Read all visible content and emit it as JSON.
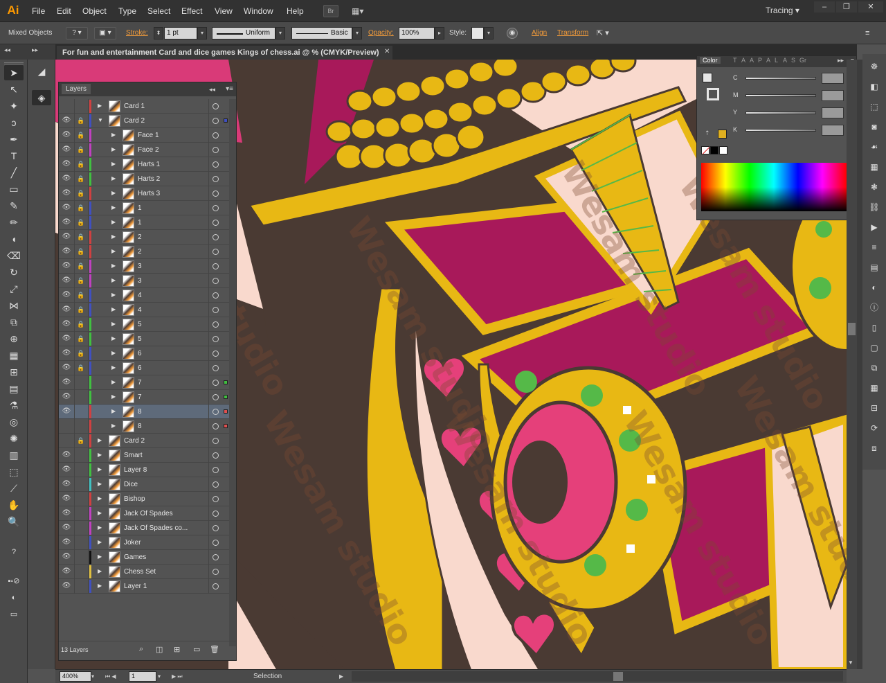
{
  "app": {
    "logo": "Ai"
  },
  "menu": [
    "File",
    "Edit",
    "Object",
    "Type",
    "Select",
    "Effect",
    "View",
    "Window",
    "Help"
  ],
  "workspace": {
    "label": "Tracing",
    "bridge_label": "Br"
  },
  "control_bar": {
    "selection_label": "Mixed Objects",
    "stroke_label": "Stroke:",
    "stroke_value": "1 pt",
    "profile_value": "Uniform",
    "brush_value": "Basic",
    "opacity_label": "Opacity:",
    "opacity_value": "100%",
    "style_label": "Style:",
    "align_label": "Align",
    "transform_label": "Transform"
  },
  "document": {
    "tab_title": "For fun and entertainment Card and dice games Kings of chess.ai @ % (CMYK/Preview)",
    "close": "✕"
  },
  "layers_panel": {
    "title": "Layers",
    "count_label": "13 Layers",
    "rows": [
      {
        "name": "Card 1",
        "indent": 0,
        "color": "#d04040",
        "eye": false,
        "lock": false,
        "expanded": false,
        "sel": "",
        "highlight": false
      },
      {
        "name": "Card 2",
        "indent": 0,
        "color": "#4050c0",
        "eye": true,
        "lock": true,
        "expanded": true,
        "sel": "#4050c0",
        "highlight": false
      },
      {
        "name": "Face 1",
        "indent": 1,
        "color": "#c040c0",
        "eye": true,
        "lock": true,
        "expanded": false,
        "sel": "",
        "highlight": false
      },
      {
        "name": "Face 2",
        "indent": 1,
        "color": "#c040c0",
        "eye": true,
        "lock": true,
        "expanded": false,
        "sel": "",
        "highlight": false
      },
      {
        "name": "Harts 1",
        "indent": 1,
        "color": "#40c040",
        "eye": true,
        "lock": true,
        "expanded": false,
        "sel": "",
        "highlight": false
      },
      {
        "name": "Harts 2",
        "indent": 1,
        "color": "#40c040",
        "eye": true,
        "lock": true,
        "expanded": false,
        "sel": "",
        "highlight": false
      },
      {
        "name": "Harts 3",
        "indent": 1,
        "color": "#d04040",
        "eye": true,
        "lock": true,
        "expanded": false,
        "sel": "",
        "highlight": false
      },
      {
        "name": "1",
        "indent": 1,
        "color": "#4050c0",
        "eye": true,
        "lock": true,
        "expanded": false,
        "sel": "",
        "highlight": false
      },
      {
        "name": "1",
        "indent": 1,
        "color": "#4050c0",
        "eye": true,
        "lock": true,
        "expanded": false,
        "sel": "",
        "highlight": false
      },
      {
        "name": "2",
        "indent": 1,
        "color": "#d04040",
        "eye": true,
        "lock": true,
        "expanded": false,
        "sel": "",
        "highlight": false
      },
      {
        "name": "2",
        "indent": 1,
        "color": "#d04040",
        "eye": true,
        "lock": true,
        "expanded": false,
        "sel": "",
        "highlight": false
      },
      {
        "name": "3",
        "indent": 1,
        "color": "#c040c0",
        "eye": true,
        "lock": true,
        "expanded": false,
        "sel": "",
        "highlight": false
      },
      {
        "name": "3",
        "indent": 1,
        "color": "#c040c0",
        "eye": true,
        "lock": true,
        "expanded": false,
        "sel": "",
        "highlight": false
      },
      {
        "name": "4",
        "indent": 1,
        "color": "#4050c0",
        "eye": true,
        "lock": true,
        "expanded": false,
        "sel": "",
        "highlight": false
      },
      {
        "name": "4",
        "indent": 1,
        "color": "#4050c0",
        "eye": true,
        "lock": true,
        "expanded": false,
        "sel": "",
        "highlight": false
      },
      {
        "name": "5",
        "indent": 1,
        "color": "#40c040",
        "eye": true,
        "lock": true,
        "expanded": false,
        "sel": "",
        "highlight": false
      },
      {
        "name": "5",
        "indent": 1,
        "color": "#40c040",
        "eye": true,
        "lock": true,
        "expanded": false,
        "sel": "",
        "highlight": false
      },
      {
        "name": "6",
        "indent": 1,
        "color": "#4050c0",
        "eye": true,
        "lock": true,
        "expanded": false,
        "sel": "",
        "highlight": false
      },
      {
        "name": "6",
        "indent": 1,
        "color": "#4050c0",
        "eye": true,
        "lock": true,
        "expanded": false,
        "sel": "",
        "highlight": false
      },
      {
        "name": "7",
        "indent": 1,
        "color": "#40c040",
        "eye": true,
        "lock": false,
        "expanded": false,
        "sel": "#40c040",
        "highlight": false
      },
      {
        "name": "7",
        "indent": 1,
        "color": "#40c040",
        "eye": true,
        "lock": false,
        "expanded": false,
        "sel": "#40c040",
        "highlight": false
      },
      {
        "name": "8",
        "indent": 1,
        "color": "#d04040",
        "eye": true,
        "lock": false,
        "expanded": false,
        "sel": "#e05050",
        "highlight": true
      },
      {
        "name": "8",
        "indent": 1,
        "color": "#d04040",
        "eye": false,
        "lock": false,
        "expanded": false,
        "sel": "#e05050",
        "highlight": false
      },
      {
        "name": "Card 2",
        "indent": 0,
        "color": "#d04040",
        "eye": false,
        "lock": true,
        "expanded": false,
        "sel": "",
        "highlight": false
      },
      {
        "name": "Smart",
        "indent": 0,
        "color": "#40c040",
        "eye": true,
        "lock": false,
        "expanded": false,
        "sel": "",
        "highlight": false
      },
      {
        "name": "Layer 8",
        "indent": 0,
        "color": "#40c040",
        "eye": true,
        "lock": false,
        "expanded": false,
        "sel": "",
        "highlight": false
      },
      {
        "name": "Dice",
        "indent": 0,
        "color": "#40c0c0",
        "eye": true,
        "lock": false,
        "expanded": false,
        "sel": "",
        "highlight": false
      },
      {
        "name": "Bishop",
        "indent": 0,
        "color": "#d04040",
        "eye": true,
        "lock": false,
        "expanded": false,
        "sel": "",
        "highlight": false
      },
      {
        "name": "Jack Of Spades",
        "indent": 0,
        "color": "#c040c0",
        "eye": true,
        "lock": false,
        "expanded": false,
        "sel": "",
        "highlight": false
      },
      {
        "name": "Jack Of Spades co...",
        "indent": 0,
        "color": "#c040c0",
        "eye": true,
        "lock": false,
        "expanded": false,
        "sel": "",
        "highlight": false
      },
      {
        "name": "Joker",
        "indent": 0,
        "color": "#4050c0",
        "eye": true,
        "lock": false,
        "expanded": false,
        "sel": "",
        "highlight": false
      },
      {
        "name": "Games",
        "indent": 0,
        "color": "#111111",
        "eye": true,
        "lock": false,
        "expanded": false,
        "sel": "",
        "highlight": false
      },
      {
        "name": "Chess Set",
        "indent": 0,
        "color": "#e0c040",
        "eye": true,
        "lock": false,
        "expanded": false,
        "sel": "",
        "highlight": false
      },
      {
        "name": "Layer 1",
        "indent": 0,
        "color": "#4050c0",
        "eye": true,
        "lock": false,
        "expanded": false,
        "sel": "",
        "highlight": false
      }
    ]
  },
  "color_panel": {
    "tabs": [
      "Color",
      "T",
      "A",
      "A",
      "P",
      "A",
      "L",
      "A",
      "S",
      "Gr"
    ],
    "sliders": [
      {
        "label": "C",
        "unit": "%"
      },
      {
        "label": "M",
        "unit": "%"
      },
      {
        "label": "Y",
        "unit": "%"
      },
      {
        "label": "K",
        "unit": "%"
      }
    ],
    "fill_color": "#e0b020"
  },
  "status_bar": {
    "zoom": "400%",
    "artboard": "1",
    "tool": "Selection"
  },
  "watermark": "Wesam studio",
  "colors": {
    "accent_orange": "#f29b3a",
    "art_brown": "#4a3a33",
    "art_gold": "#e8b814",
    "art_magenta": "#a8195a",
    "art_pink": "#e5407a",
    "art_cream": "#f9d9cd",
    "art_green": "#55b948"
  }
}
